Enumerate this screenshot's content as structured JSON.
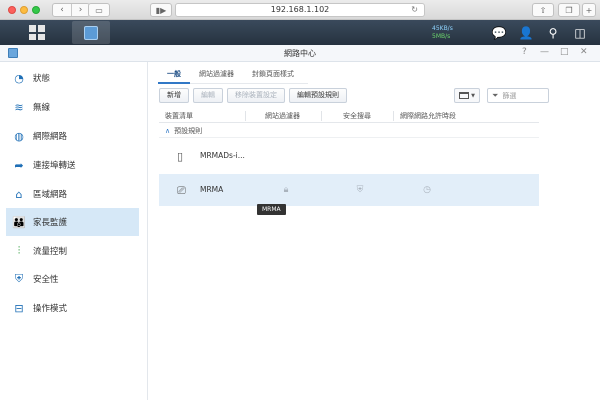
{
  "browser": {
    "url": "192.168.1.102"
  },
  "taskbar": {
    "speed_up": "45KB/s",
    "speed_down": "5MB/s"
  },
  "window": {
    "title": "網路中心",
    "help": "?",
    "minimize": "—",
    "maximize": "□",
    "close": "✕"
  },
  "sidebar": {
    "items": [
      {
        "label": "狀態",
        "icon": "status-icon"
      },
      {
        "label": "無線",
        "icon": "wifi-icon"
      },
      {
        "label": "網際網路",
        "icon": "globe-icon"
      },
      {
        "label": "連接埠轉送",
        "icon": "arrow-forward-icon"
      },
      {
        "label": "區域網路",
        "icon": "home-network-icon"
      },
      {
        "label": "家長監護",
        "icon": "family-icon",
        "active": true
      },
      {
        "label": "流量控制",
        "icon": "sliders-icon"
      },
      {
        "label": "安全性",
        "icon": "shield-icon"
      },
      {
        "label": "操作模式",
        "icon": "router-icon"
      }
    ]
  },
  "tabs": [
    "一般",
    "網站過濾器",
    "封鎖頁面樣式"
  ],
  "toolbar": {
    "add": "新增",
    "edit": "編輯",
    "remove": "移除裝置設定",
    "edit_default": "編輯預設規則"
  },
  "filter": {
    "placeholder": "篩選"
  },
  "table": {
    "columns": [
      "裝置清單",
      "網站過濾器",
      "安全搜尋",
      "網際網路允許時段"
    ],
    "group": "預設規則",
    "rows": [
      {
        "name": "MRMADs-i..."
      },
      {
        "name": "MRMA",
        "selected": true
      }
    ]
  },
  "tooltip": "MRMA"
}
